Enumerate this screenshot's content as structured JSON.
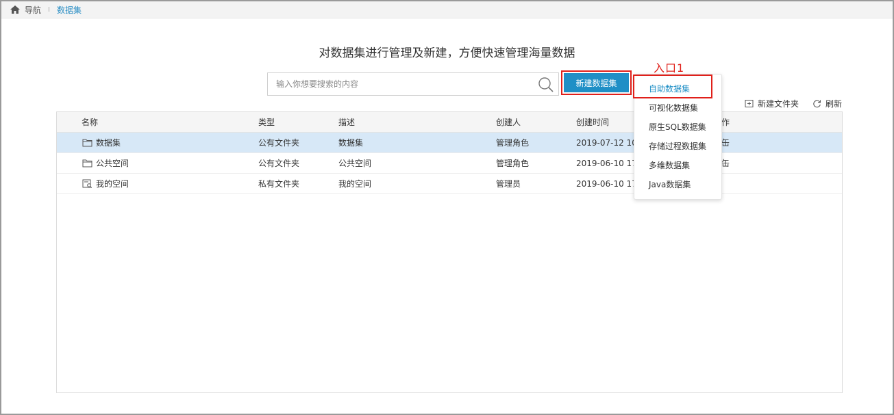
{
  "nav": {
    "home_label": "导航",
    "separator": "I",
    "current": "数据集"
  },
  "headline": "对数据集进行管理及新建，方便快速管理海量数据",
  "search": {
    "placeholder": "输入你想要搜索的内容"
  },
  "new_button": {
    "label": "新建数据集"
  },
  "annotation": {
    "entry": "入口1"
  },
  "toolbar": {
    "new_folder": "新建文件夹",
    "refresh": "刷新"
  },
  "table": {
    "columns": [
      "名称",
      "类型",
      "描述",
      "创建人",
      "创建时间",
      "作"
    ],
    "rows": [
      {
        "name": "数据集",
        "type": "公有文件夹",
        "desc": "数据集",
        "creator": "管理角色",
        "time": "2019-07-12 10",
        "op": "缶",
        "icon": "folder-icon"
      },
      {
        "name": "公共空间",
        "type": "公有文件夹",
        "desc": "公共空间",
        "creator": "管理角色",
        "time": "2019-06-10 17",
        "op": "缶",
        "icon": "folder-icon"
      },
      {
        "name": "我的空间",
        "type": "私有文件夹",
        "desc": "我的空间",
        "creator": "管理员",
        "time": "2019-06-10 17",
        "op": "",
        "icon": "private-folder-icon"
      }
    ]
  },
  "dropdown": {
    "items": [
      "自助数据集",
      "可视化数据集",
      "原生SQL数据集",
      "存储过程数据集",
      "多维数据集",
      "Java数据集"
    ]
  },
  "colors": {
    "accent": "#1f8fc6",
    "annotation_red": "#e0201a",
    "selected_row": "#d7e8f7"
  }
}
